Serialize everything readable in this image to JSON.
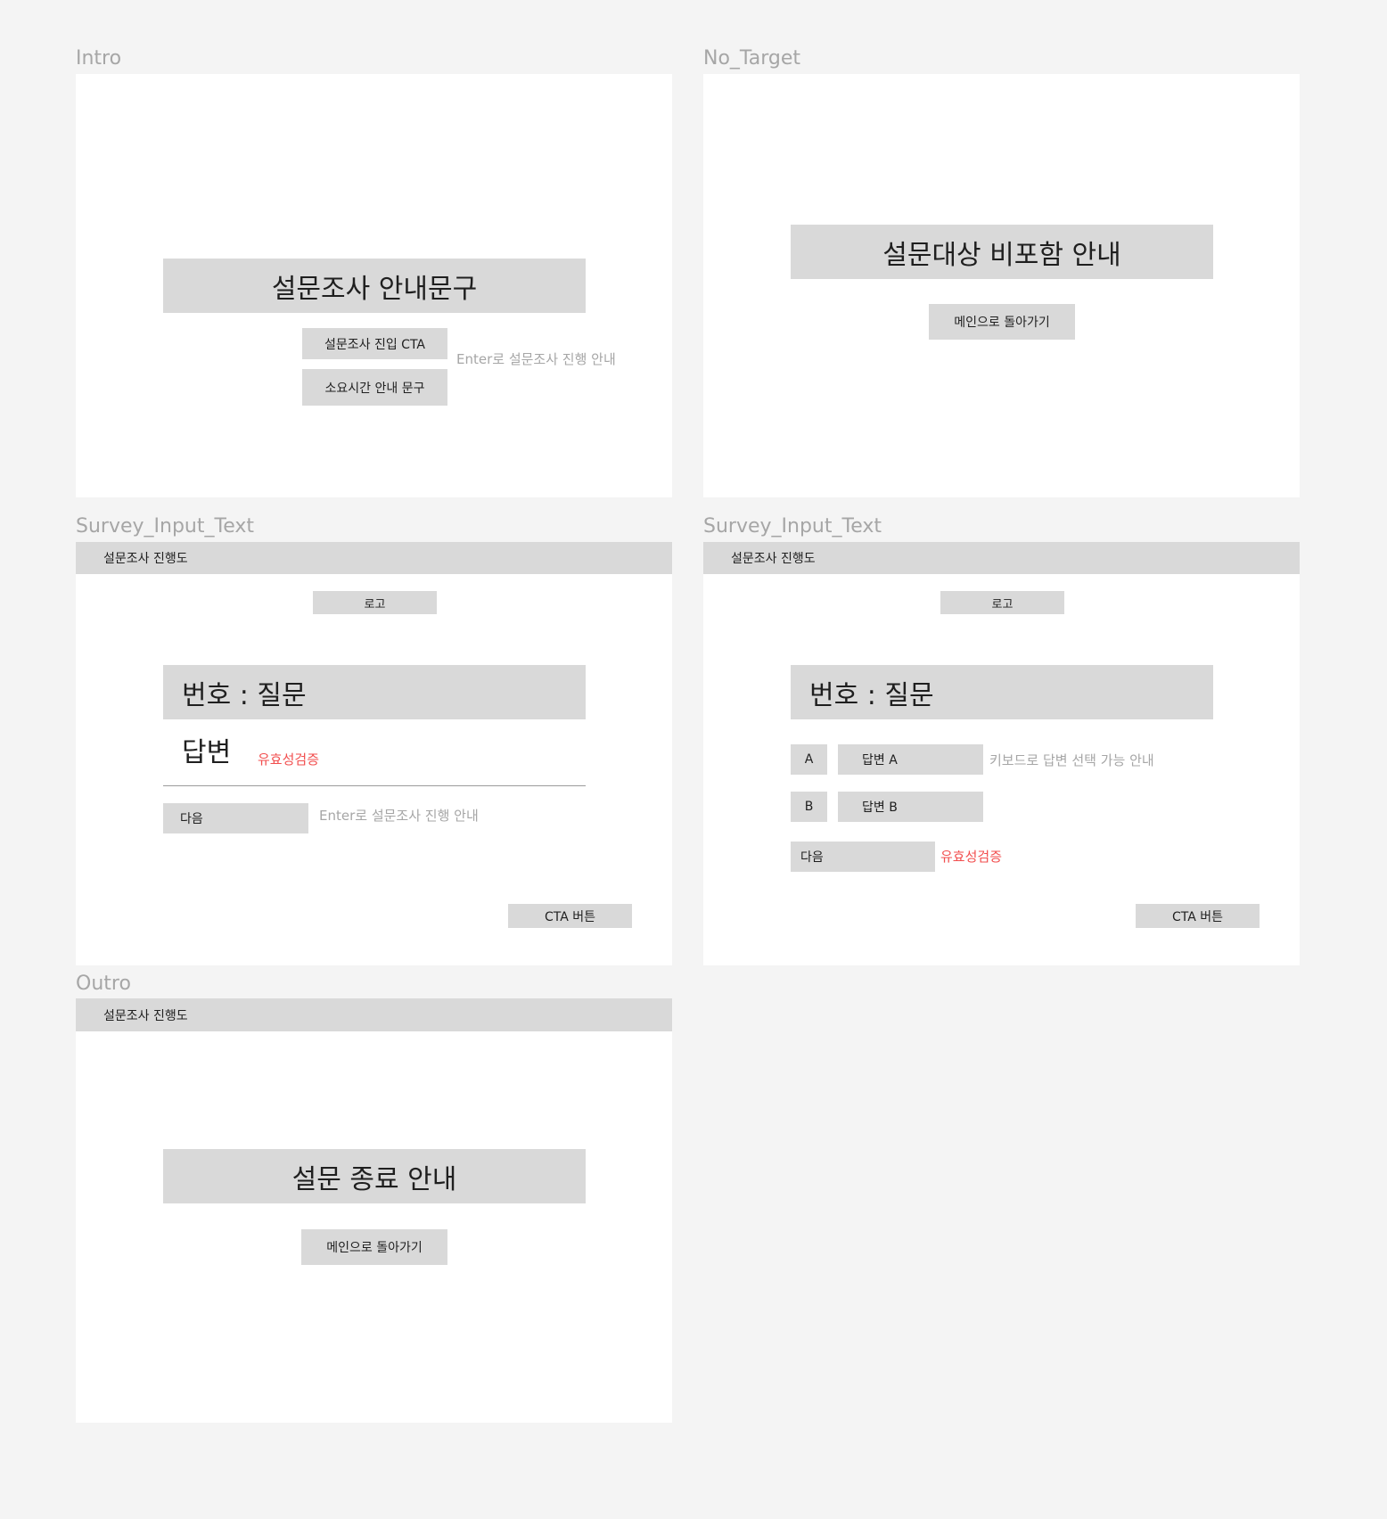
{
  "frames": {
    "intro": {
      "label": "Intro",
      "headline": "설문조사 안내문구",
      "cta": "설문조사 진입 CTA",
      "duration": "소요시간 안내 문구",
      "hint": "Enter로 설문조사 진행 안내"
    },
    "no_target": {
      "label": "No_Target",
      "headline": "설문대상 비포함 안내",
      "back": "메인으로 돌아가기"
    },
    "survey_text": {
      "label": "Survey_Input_Text",
      "progress": "설문조사 진행도",
      "logo": "로고",
      "question": "번호 : 질문",
      "answer": "답변",
      "validation": "유효성검증",
      "next": "다음",
      "hint": "Enter로 설문조사 진행 안내",
      "cta": "CTA 버튼"
    },
    "survey_choice": {
      "label": "Survey_Input_Text",
      "progress": "설문조사 진행도",
      "logo": "로고",
      "question": "번호 : 질문",
      "options": [
        {
          "key": "A",
          "label": "답변 A"
        },
        {
          "key": "B",
          "label": "답변 B"
        }
      ],
      "keyboard_hint": "키보드로 답변 선택 가능 안내",
      "next": "다음",
      "validation": "유효성검증",
      "cta": "CTA 버튼"
    },
    "outro": {
      "label": "Outro",
      "progress": "설문조사 진행도",
      "headline": "설문 종료 안내",
      "back": "메인으로 돌아가기"
    }
  },
  "colors": {
    "canvas": "#f4f4f4",
    "frame": "#ffffff",
    "placeholder": "#d9d9d9",
    "muted": "#a6a6a6",
    "error": "#f24e4e"
  }
}
